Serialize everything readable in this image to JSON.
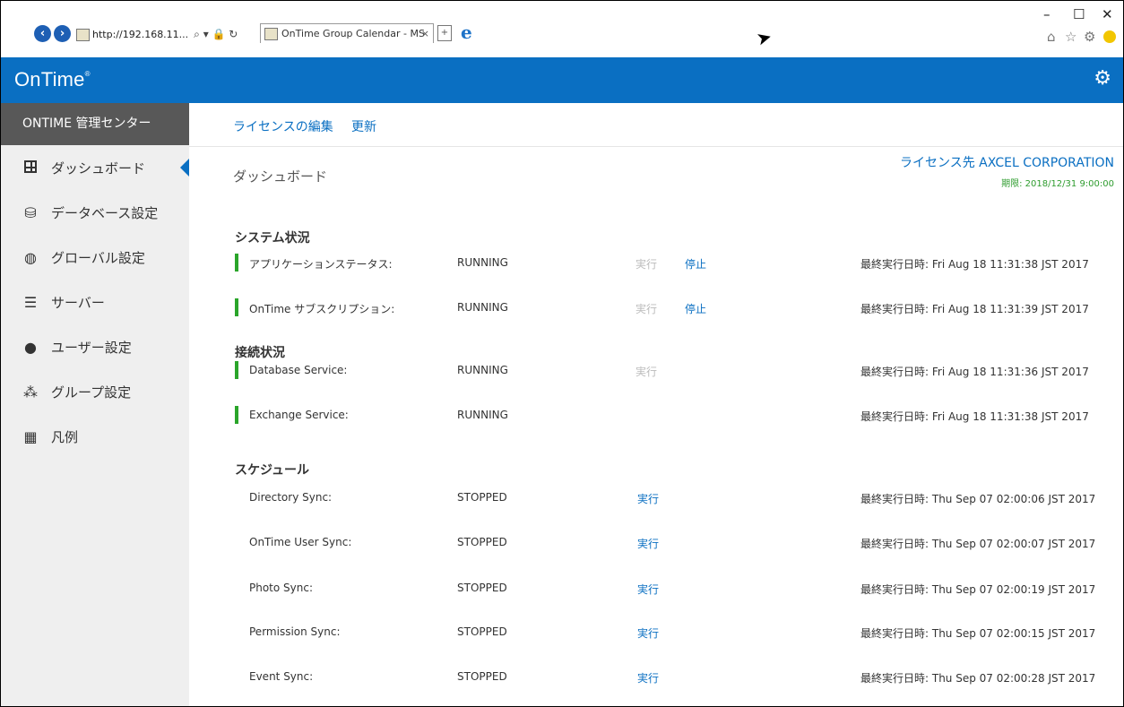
{
  "browser": {
    "address": "http://192.168.11...",
    "address_controls": "⌕ ▾ 🔒 ↻",
    "tab_title": "OnTime Group Calendar - MS",
    "tab_close": "×",
    "window_controls": {
      "minimize": "–",
      "maximize": "☐",
      "close": "✕"
    },
    "toolbar_icons": [
      "home-icon",
      "star-icon",
      "gear-icon",
      "smiley-icon"
    ]
  },
  "app": {
    "logo": "OnTime",
    "logo_mark": "®"
  },
  "sidebar": {
    "header": "ONTIME 管理センター",
    "items": [
      {
        "label": "ダッシュボード",
        "icon": "dashboard-icon",
        "active": true
      },
      {
        "label": "データベース設定",
        "icon": "database-icon"
      },
      {
        "label": "グローバル設定",
        "icon": "globe-icon"
      },
      {
        "label": "サーバー",
        "icon": "server-icon"
      },
      {
        "label": "ユーザー設定",
        "icon": "user-icon"
      },
      {
        "label": "グループ設定",
        "icon": "group-icon"
      },
      {
        "label": "凡例",
        "icon": "grid-icon"
      }
    ]
  },
  "topnav": {
    "edit_license": "ライセンスの編集",
    "refresh": "更新"
  },
  "page": {
    "title": "ダッシュボード",
    "license_holder": "ライセンス先 AXCEL CORPORATION",
    "license_expiry": "期限: 2018/12/31 9:00:00"
  },
  "sections": {
    "system": "システム状況",
    "connection": "接続状況",
    "schedule": "スケジュール"
  },
  "system_rows": [
    {
      "label": "アプリケーションステータス:",
      "status": "RUNNING",
      "run": "実行",
      "stop": "停止",
      "last_run": "最終実行日時: Fri Aug 18 11:31:38 JST 2017"
    },
    {
      "label": "OnTime サブスクリプション:",
      "status": "RUNNING",
      "run": "実行",
      "stop": "停止",
      "last_run": "最終実行日時: Fri Aug 18 11:31:39 JST 2017"
    }
  ],
  "connection_rows": [
    {
      "label": "Database Service:",
      "status": "RUNNING",
      "run": "実行",
      "last_run": "最終実行日時: Fri Aug 18 11:31:36 JST 2017"
    },
    {
      "label": "Exchange Service:",
      "status": "RUNNING",
      "last_run": "最終実行日時: Fri Aug 18 11:31:38 JST 2017"
    }
  ],
  "schedule_rows": [
    {
      "label": "Directory Sync:",
      "status": "STOPPED",
      "run": "実行",
      "last_run": "最終実行日時: Thu Sep 07 02:00:06 JST 2017"
    },
    {
      "label": "OnTime User Sync:",
      "status": "STOPPED",
      "run": "実行",
      "last_run": "最終実行日時: Thu Sep 07 02:00:07 JST 2017"
    },
    {
      "label": "Photo Sync:",
      "status": "STOPPED",
      "run": "実行",
      "last_run": "最終実行日時: Thu Sep 07 02:00:19 JST 2017"
    },
    {
      "label": "Permission Sync:",
      "status": "STOPPED",
      "run": "実行",
      "last_run": "最終実行日時: Thu Sep 07 02:00:15 JST 2017"
    },
    {
      "label": "Event Sync:",
      "status": "STOPPED",
      "run": "実行",
      "last_run": "最終実行日時: Thu Sep 07 02:00:28 JST 2017"
    }
  ],
  "colors": {
    "brand": "#0a6fc2",
    "running": "#2aa52a",
    "expiry": "#2e9c2e",
    "disabled": "#bbbbbb",
    "sidebar_header": "#585858"
  }
}
